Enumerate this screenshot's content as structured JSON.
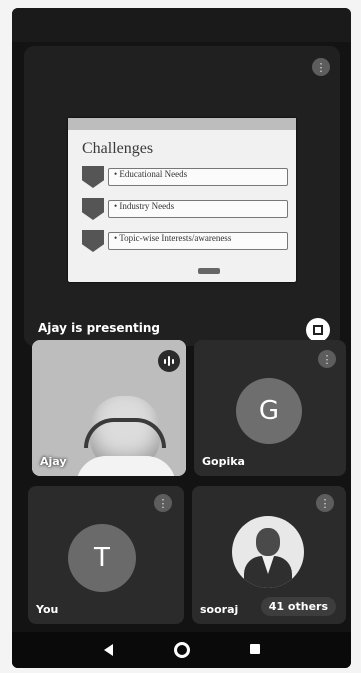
{
  "presentation": {
    "presenting_label": "Ajay is presenting",
    "slide": {
      "title": "Challenges",
      "bullets": [
        "• Educational Needs",
        "• Industry Needs",
        "• Topic-wise Interests/awareness"
      ]
    }
  },
  "participants": [
    {
      "name": "Ajay",
      "type": "video"
    },
    {
      "name": "Gopika",
      "type": "avatar",
      "initial": "G",
      "color": "#6e6e6e"
    },
    {
      "name": "You",
      "type": "avatar",
      "initial": "T",
      "color": "#6a6a6a"
    },
    {
      "name": "sooraj",
      "type": "photo",
      "others_label": "41 others"
    }
  ],
  "icons": {
    "tile_menu": "more-vert-icon",
    "fullscreen": "fullscreen-icon",
    "speaking": "speaking-indicator-icon",
    "nav_back": "back-icon",
    "nav_home": "home-icon",
    "nav_recent": "recents-icon"
  }
}
